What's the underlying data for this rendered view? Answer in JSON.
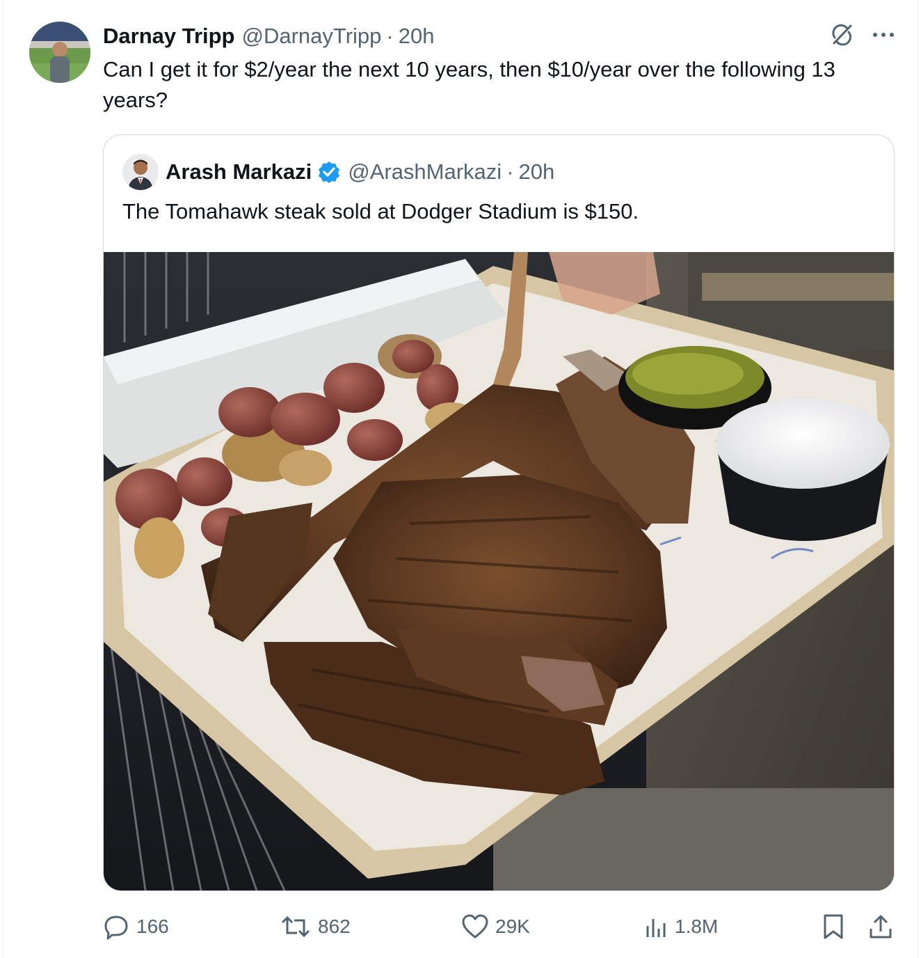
{
  "tweet": {
    "author_name": "Darnay Tripp",
    "handle": "@DarnayTripp",
    "separator": "·",
    "time": "20h",
    "text": "Can I get it for $2/year the next 10 years, then $10/year over the following 13 years?",
    "more_label": "···"
  },
  "quoted_tweet": {
    "author_name": "Arash Markazi",
    "handle": "@ArashMarkazi",
    "separator": "·",
    "time": "20h",
    "verified": true,
    "text": "The Tomahawk steak sold at Dodger Stadium is $150."
  },
  "actions": {
    "replies": "166",
    "reposts": "862",
    "likes": "29K",
    "views": "1.8M"
  },
  "colors": {
    "text_primary": "#0f1419",
    "text_muted": "#536471",
    "border": "#cfd9de",
    "verified_blue": "#1d9bf0"
  },
  "icons": [
    "grok-icon",
    "more-icon",
    "verified-badge-icon",
    "reply-icon",
    "repost-icon",
    "like-icon",
    "views-icon",
    "bookmark-icon",
    "share-icon"
  ]
}
